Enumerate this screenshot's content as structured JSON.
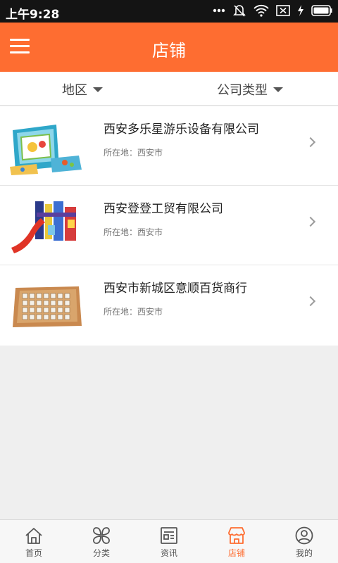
{
  "status_bar": {
    "time": "上午9:28",
    "icons": [
      "dots-icon",
      "mute-icon",
      "wifi-icon",
      "sim-icon",
      "battery-icon"
    ]
  },
  "app_bar": {
    "title": "店铺",
    "menu_icon": "hamburger-menu-icon"
  },
  "filters": {
    "region_label": "地区",
    "type_label": "公司类型"
  },
  "shops": [
    {
      "name": "西安多乐星游乐设备有限公司",
      "location": "所在地：西安市",
      "image": "board-game-box"
    },
    {
      "name": "西安登登工贸有限公司",
      "location": "所在地：西安市",
      "image": "playground-slide"
    },
    {
      "name": "西安市新城区意顺百货商行",
      "location": "所在地：西安市",
      "image": "wooden-dice-board"
    }
  ],
  "tabs": [
    {
      "label": "首页",
      "icon": "home-icon",
      "active": false
    },
    {
      "label": "分类",
      "icon": "category-icon",
      "active": false
    },
    {
      "label": "资讯",
      "icon": "news-icon",
      "active": false
    },
    {
      "label": "店铺",
      "icon": "shop-icon",
      "active": true
    },
    {
      "label": "我的",
      "icon": "profile-icon",
      "active": false
    }
  ],
  "colors": {
    "accent": "#fe6d31",
    "status_bar": "#141414",
    "background": "#efefef"
  }
}
